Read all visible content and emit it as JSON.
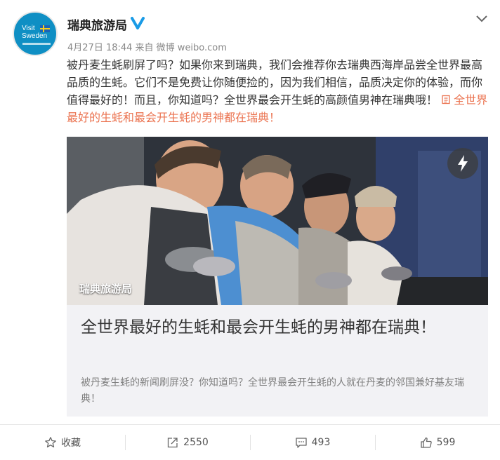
{
  "post": {
    "avatar": {
      "logo_text": "Visit Sweden"
    },
    "username": "瑞典旅游局",
    "meta": "4月27日 18:44 来自 微博 weibo.com",
    "text": "被丹麦生蚝刷屏了吗？如果你来到瑞典，我们会推荐你去瑞典西海岸品尝全世界最高品质的生蚝。它们不是免费让你随便捡的，因为我们相信，品质决定你的体验，而你值得最好的！而且，你知道吗？全世界最会开生蚝的高颜值男神在瑞典哦！",
    "link_text": "全世界最好的生蚝和最会开生蚝的男神都在瑞典！",
    "link_icon": "article-icon"
  },
  "card": {
    "image_caption": "瑞典旅游局",
    "title": "全世界最好的生蚝和最会开生蚝的男神都在瑞典！",
    "description": "被丹麦生蚝的新闻刷屏没？你知道吗？全世界最会开生蚝的人就在丹麦的邻国兼好基友瑞典！"
  },
  "actions": {
    "favorite": "收藏",
    "repost": "2550",
    "comment": "493",
    "like": "599"
  },
  "colors": {
    "link": "#eb7350",
    "verified": "#1a9be6",
    "brand": "#0f8fc4"
  }
}
